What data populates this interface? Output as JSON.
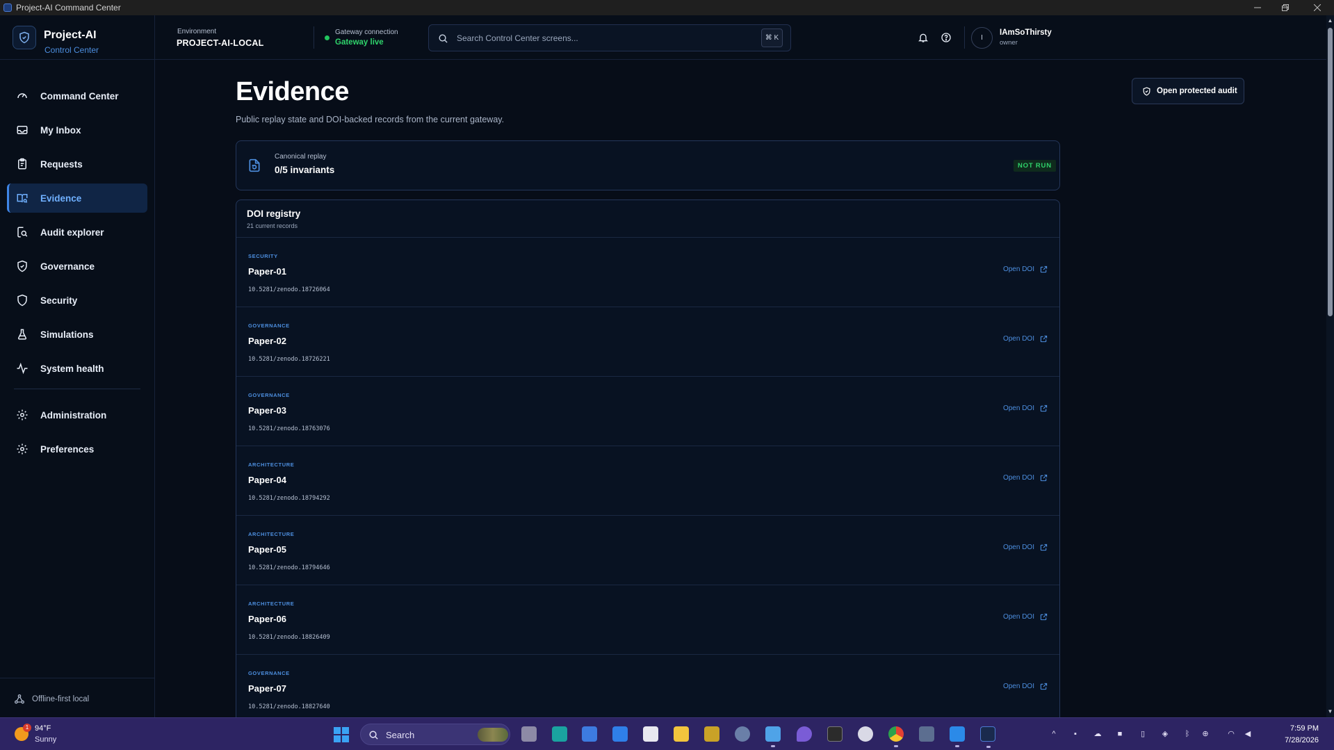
{
  "window": {
    "title": "Project-AI Command Center"
  },
  "brand": {
    "name": "Project-AI",
    "subtitle": "Control Center"
  },
  "sidebar": {
    "items": [
      {
        "label": "Command Center",
        "icon": "gauge-icon"
      },
      {
        "label": "My Inbox",
        "icon": "inbox-icon"
      },
      {
        "label": "Requests",
        "icon": "clipboard-icon"
      },
      {
        "label": "Evidence",
        "icon": "book-search-icon",
        "active": true
      },
      {
        "label": "Audit explorer",
        "icon": "search-log-icon"
      },
      {
        "label": "Governance",
        "icon": "shield-check-icon"
      },
      {
        "label": "Security",
        "icon": "shield-icon"
      },
      {
        "label": "Simulations",
        "icon": "flask-icon"
      },
      {
        "label": "System health",
        "icon": "activity-icon"
      }
    ],
    "secondary": [
      {
        "label": "Administration",
        "icon": "gear-icon"
      },
      {
        "label": "Preferences",
        "icon": "gear-icon"
      }
    ],
    "footer": "Offline-first local"
  },
  "header": {
    "environment_label": "Environment",
    "environment_value": "PROJECT-AI-LOCAL",
    "gateway_label": "Gateway connection",
    "gateway_value": "Gateway live",
    "search_placeholder": "Search Control Center screens...",
    "shortcut": "⌘ K",
    "user_initial": "I",
    "user_name": "IAmSoThirsty",
    "user_role": "owner"
  },
  "page": {
    "title": "Evidence",
    "subtitle": "Public replay state and DOI-backed records from the current gateway.",
    "audit_button": "Open protected audit"
  },
  "replay": {
    "label": "Canonical replay",
    "value": "0/5 invariants",
    "status": "NOT RUN"
  },
  "registry": {
    "title": "DOI registry",
    "count": "21 current records",
    "link_label": "Open DOI",
    "records": [
      {
        "category": "SECURITY",
        "name": "Paper-01",
        "doi": "10.5281/zenodo.18726064"
      },
      {
        "category": "GOVERNANCE",
        "name": "Paper-02",
        "doi": "10.5281/zenodo.18726221"
      },
      {
        "category": "GOVERNANCE",
        "name": "Paper-03",
        "doi": "10.5281/zenodo.18763076"
      },
      {
        "category": "ARCHITECTURE",
        "name": "Paper-04",
        "doi": "10.5281/zenodo.18794292"
      },
      {
        "category": "ARCHITECTURE",
        "name": "Paper-05",
        "doi": "10.5281/zenodo.18794646"
      },
      {
        "category": "ARCHITECTURE",
        "name": "Paper-06",
        "doi": "10.5281/zenodo.18826409"
      },
      {
        "category": "GOVERNANCE",
        "name": "Paper-07",
        "doi": "10.5281/zenodo.18827640"
      }
    ]
  },
  "taskbar": {
    "weather_temp": "94°F",
    "weather_condition": "Sunny",
    "weather_badge": "1",
    "search_label": "Search",
    "time": "7:59 PM",
    "date": "7/28/2026"
  },
  "colors": {
    "accent": "#4d8fe0",
    "live": "#2fd36b",
    "background": "#070d18",
    "taskbar": "#2d2463"
  }
}
